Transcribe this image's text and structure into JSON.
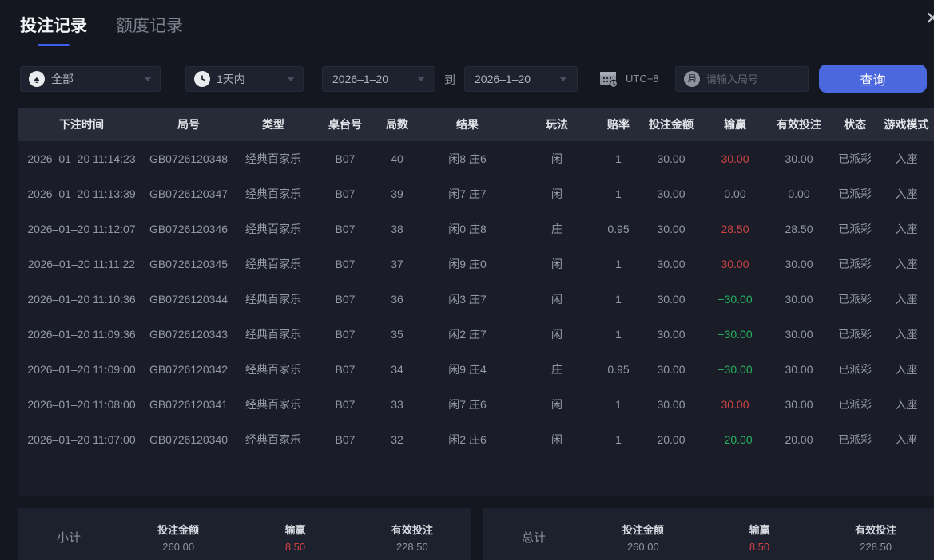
{
  "window": {
    "close_icon": "×"
  },
  "tabs": [
    {
      "label": "投注记录",
      "active": true
    },
    {
      "label": "额度记录",
      "active": false
    }
  ],
  "filters": {
    "game_type": {
      "value": "全部",
      "icon": "spade"
    },
    "time_range": {
      "value": "1天内",
      "icon": "clock"
    },
    "date_from": "2026–1–20",
    "to_label": "到",
    "date_to": "2026–1–20",
    "timezone_label": "UTC+8",
    "round_icon_char": "局",
    "round_placeholder": "请输入局号",
    "query_button": "查询"
  },
  "table": {
    "headers": [
      "下注时间",
      "局号",
      "类型",
      "桌台号",
      "局数",
      "结果",
      "玩法",
      "赔率",
      "投注金额",
      "输赢",
      "有效投注",
      "状态",
      "游戏模式"
    ],
    "rows": [
      {
        "time": "2026–01–20 11:14:23",
        "round": "GB0726120348",
        "type": "经典百家乐",
        "table_no": "B07",
        "count": "40",
        "result": "闲8 庄6",
        "play": "闲",
        "odds": "1",
        "bet": "30.00",
        "winloss": "30.00",
        "winloss_sign": "win",
        "valid": "30.00",
        "status": "已派彩",
        "mode": "入座"
      },
      {
        "time": "2026–01–20 11:13:39",
        "round": "GB0726120347",
        "type": "经典百家乐",
        "table_no": "B07",
        "count": "39",
        "result": "闲7 庄7",
        "play": "闲",
        "odds": "1",
        "bet": "30.00",
        "winloss": "0.00",
        "winloss_sign": "zero",
        "valid": "0.00",
        "status": "已派彩",
        "mode": "入座"
      },
      {
        "time": "2026–01–20 11:12:07",
        "round": "GB0726120346",
        "type": "经典百家乐",
        "table_no": "B07",
        "count": "38",
        "result": "闲0 庄8",
        "play": "庄",
        "odds": "0.95",
        "bet": "30.00",
        "winloss": "28.50",
        "winloss_sign": "win",
        "valid": "28.50",
        "status": "已派彩",
        "mode": "入座"
      },
      {
        "time": "2026–01–20 11:11:22",
        "round": "GB0726120345",
        "type": "经典百家乐",
        "table_no": "B07",
        "count": "37",
        "result": "闲9 庄0",
        "play": "闲",
        "odds": "1",
        "bet": "30.00",
        "winloss": "30.00",
        "winloss_sign": "win",
        "valid": "30.00",
        "status": "已派彩",
        "mode": "入座"
      },
      {
        "time": "2026–01–20 11:10:36",
        "round": "GB0726120344",
        "type": "经典百家乐",
        "table_no": "B07",
        "count": "36",
        "result": "闲3 庄7",
        "play": "闲",
        "odds": "1",
        "bet": "30.00",
        "winloss": "−30.00",
        "winloss_sign": "loss",
        "valid": "30.00",
        "status": "已派彩",
        "mode": "入座"
      },
      {
        "time": "2026–01–20 11:09:36",
        "round": "GB0726120343",
        "type": "经典百家乐",
        "table_no": "B07",
        "count": "35",
        "result": "闲2 庄7",
        "play": "闲",
        "odds": "1",
        "bet": "30.00",
        "winloss": "−30.00",
        "winloss_sign": "loss",
        "valid": "30.00",
        "status": "已派彩",
        "mode": "入座"
      },
      {
        "time": "2026–01–20 11:09:00",
        "round": "GB0726120342",
        "type": "经典百家乐",
        "table_no": "B07",
        "count": "34",
        "result": "闲9 庄4",
        "play": "庄",
        "odds": "0.95",
        "bet": "30.00",
        "winloss": "−30.00",
        "winloss_sign": "loss",
        "valid": "30.00",
        "status": "已派彩",
        "mode": "入座"
      },
      {
        "time": "2026–01–20 11:08:00",
        "round": "GB0726120341",
        "type": "经典百家乐",
        "table_no": "B07",
        "count": "33",
        "result": "闲7 庄6",
        "play": "闲",
        "odds": "1",
        "bet": "30.00",
        "winloss": "30.00",
        "winloss_sign": "win",
        "valid": "30.00",
        "status": "已派彩",
        "mode": "入座"
      },
      {
        "time": "2026–01–20 11:07:00",
        "round": "GB0726120340",
        "type": "经典百家乐",
        "table_no": "B07",
        "count": "32",
        "result": "闲2 庄6",
        "play": "闲",
        "odds": "1",
        "bet": "20.00",
        "winloss": "−20.00",
        "winloss_sign": "loss",
        "valid": "20.00",
        "status": "已派彩",
        "mode": "入座"
      }
    ]
  },
  "summary": {
    "subtotal": {
      "title": "小计",
      "bet_label": "投注金额",
      "bet": "260.00",
      "winloss_label": "输赢",
      "winloss": "8.50",
      "valid_label": "有效投注",
      "valid": "228.50"
    },
    "total": {
      "title": "总计",
      "bet_label": "投注金额",
      "bet": "260.00",
      "winloss_label": "输赢",
      "winloss": "8.50",
      "valid_label": "有效投注",
      "valid": "228.50"
    }
  },
  "colors": {
    "accent_blue": "#4c68df",
    "tab_underline": "#3d5ef0",
    "win_red": "#d24444",
    "loss_green": "#25b15f"
  }
}
